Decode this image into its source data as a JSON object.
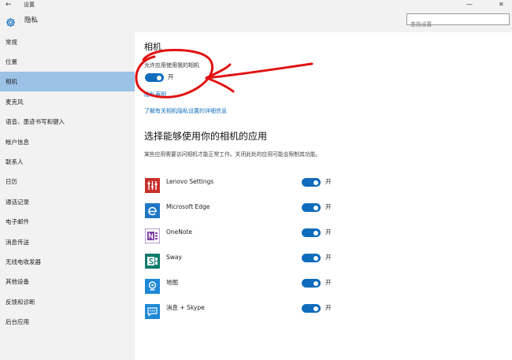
{
  "window": {
    "back_glyph": "←",
    "title": "设置",
    "minimize": "—",
    "maximize": "☐",
    "close": "✕"
  },
  "header": {
    "heading": "隐私",
    "search_placeholder": "查找设置"
  },
  "sidebar": {
    "items": [
      {
        "label": "常规"
      },
      {
        "label": "位置"
      },
      {
        "label": "相机",
        "active": true
      },
      {
        "label": "麦克风"
      },
      {
        "label": "语音、墨迹书写和键入"
      },
      {
        "label": "帐户信息"
      },
      {
        "label": "联系人"
      },
      {
        "label": "日历"
      },
      {
        "label": "通话记录"
      },
      {
        "label": "电子邮件"
      },
      {
        "label": "消息传送"
      },
      {
        "label": "无线电收发器"
      },
      {
        "label": "其他设备"
      },
      {
        "label": "反馈和诊断"
      },
      {
        "label": "后台应用"
      }
    ]
  },
  "main": {
    "title": "相机",
    "allow_label": "允许应用使用我的相机",
    "allow_state": "开",
    "privacy_statement_link": "隐私声明",
    "learn_more_link": "了解有关相机隐私设置的详细信息",
    "apps_heading": "选择能够使用你的相机的应用",
    "apps_description": "某些应用需要访问相机才能正常工作。关闭此处的应用可能会限制其功能。",
    "apps": [
      {
        "name": "Lenovo Settings",
        "state": "开",
        "icon": "lenovo-settings-icon",
        "color": "#c8312b"
      },
      {
        "name": "Microsoft Edge",
        "state": "开",
        "icon": "edge-icon",
        "color": "#1e77c5"
      },
      {
        "name": "OneNote",
        "state": "开",
        "icon": "onenote-icon",
        "color": "#7b3ea0"
      },
      {
        "name": "Sway",
        "state": "开",
        "icon": "sway-icon",
        "color": "#0f7b6c"
      },
      {
        "name": "地图",
        "state": "开",
        "icon": "maps-icon",
        "color": "#1e88d6"
      },
      {
        "name": "消息 + Skype",
        "state": "开",
        "icon": "skype-messaging-icon",
        "color": "#1e88d6"
      }
    ]
  },
  "colors": {
    "accent": "#0f6cbd",
    "sidebar_bg": "#f2f2f2",
    "active_item": "#9cc2e7",
    "annotation": "#e01212"
  }
}
